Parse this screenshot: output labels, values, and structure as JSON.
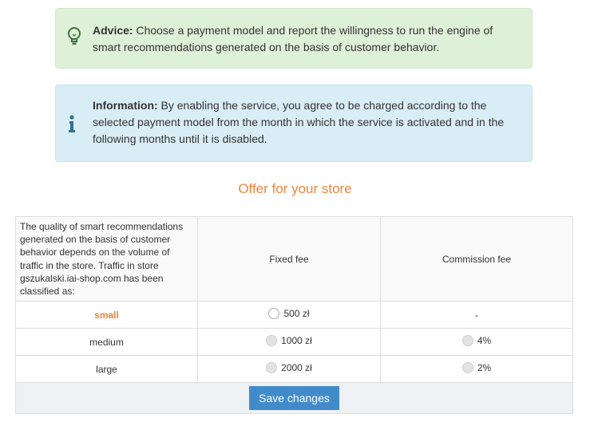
{
  "advice": {
    "label": "Advice:",
    "text": " Choose a payment model and report the willingness to run the engine of smart recommendations generated on the basis of customer behavior."
  },
  "information": {
    "label": "Information:",
    "text": " By enabling the service, you agree to be charged according to the selected payment model from the month in which the service is activated and in the following months until it is disabled."
  },
  "offer_heading": "Offer for your store",
  "table": {
    "description": "The quality of smart recommendations generated on the basis of customer behavior depends on the volume of traffic in the store. Traffic in store gszukalski.iai-shop.com has been classified as:",
    "col_fixed": "Fixed fee",
    "col_commission": "Commission fee",
    "rows": [
      {
        "tier": "small",
        "fixed": "500 zł",
        "commission": "-"
      },
      {
        "tier": "medium",
        "fixed": "1000 zł",
        "commission": "4%"
      },
      {
        "tier": "large",
        "fixed": "2000 zł",
        "commission": "2%"
      }
    ]
  },
  "save_label": "Save changes",
  "colors": {
    "accent": "#f0843c",
    "button": "#428bca",
    "advice_bg": "#dff0d8",
    "info_bg": "#d9edf7"
  },
  "icons": {
    "advice": "lightbulb-icon",
    "information": "info-icon"
  }
}
